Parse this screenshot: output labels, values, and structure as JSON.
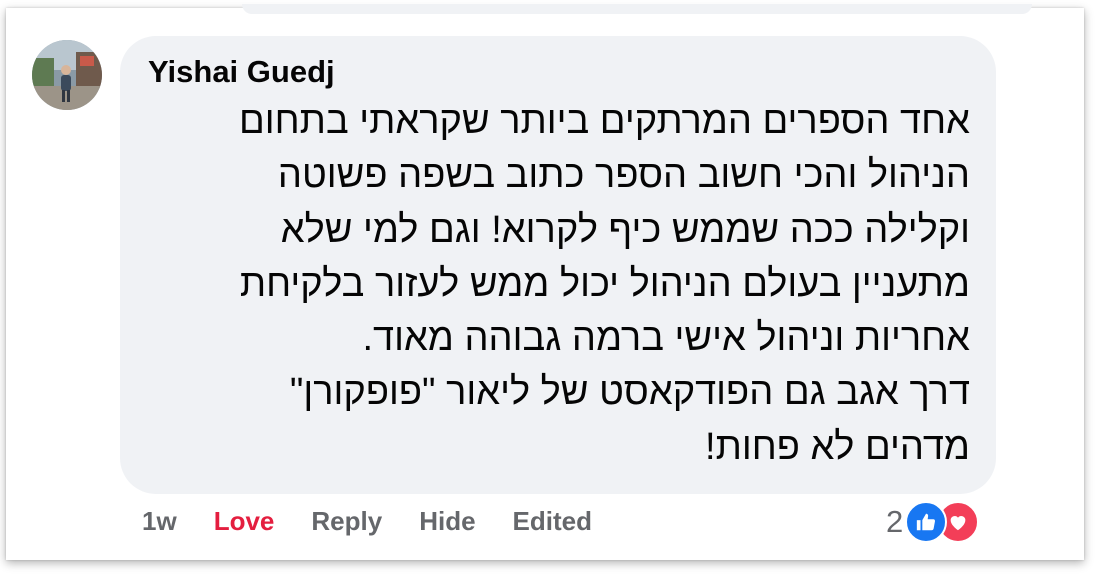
{
  "comment": {
    "author": "Yishai Guedj",
    "text_lines": [
      "אחד הספרים המרתקים ביותר שקראתי בתחום",
      "הניהול והכי חשוב הספר כתוב בשפה פשוטה",
      "וקלילה ככה שממש כיף לקרוא! וגם למי שלא",
      "מתעניין בעולם הניהול יכול ממש לעזור בלקיחת",
      "אחריות וניהול אישי ברמה גבוהה מאוד.",
      "דרך אגב גם הפודקאסט של ליאור \"פופקורן\"",
      "מדהים לא פחות!"
    ]
  },
  "actions": {
    "time": "1w",
    "love": "Love",
    "reply": "Reply",
    "hide": "Hide",
    "edited": "Edited"
  },
  "reactions": {
    "count": "2",
    "icons": [
      "like-icon",
      "heart-icon"
    ]
  },
  "colors": {
    "bubble": "#f0f2f5",
    "text": "#050505",
    "muted": "#65676b",
    "love": "#e41e3f",
    "like": "#1877f2",
    "heart": "#f33e58"
  }
}
